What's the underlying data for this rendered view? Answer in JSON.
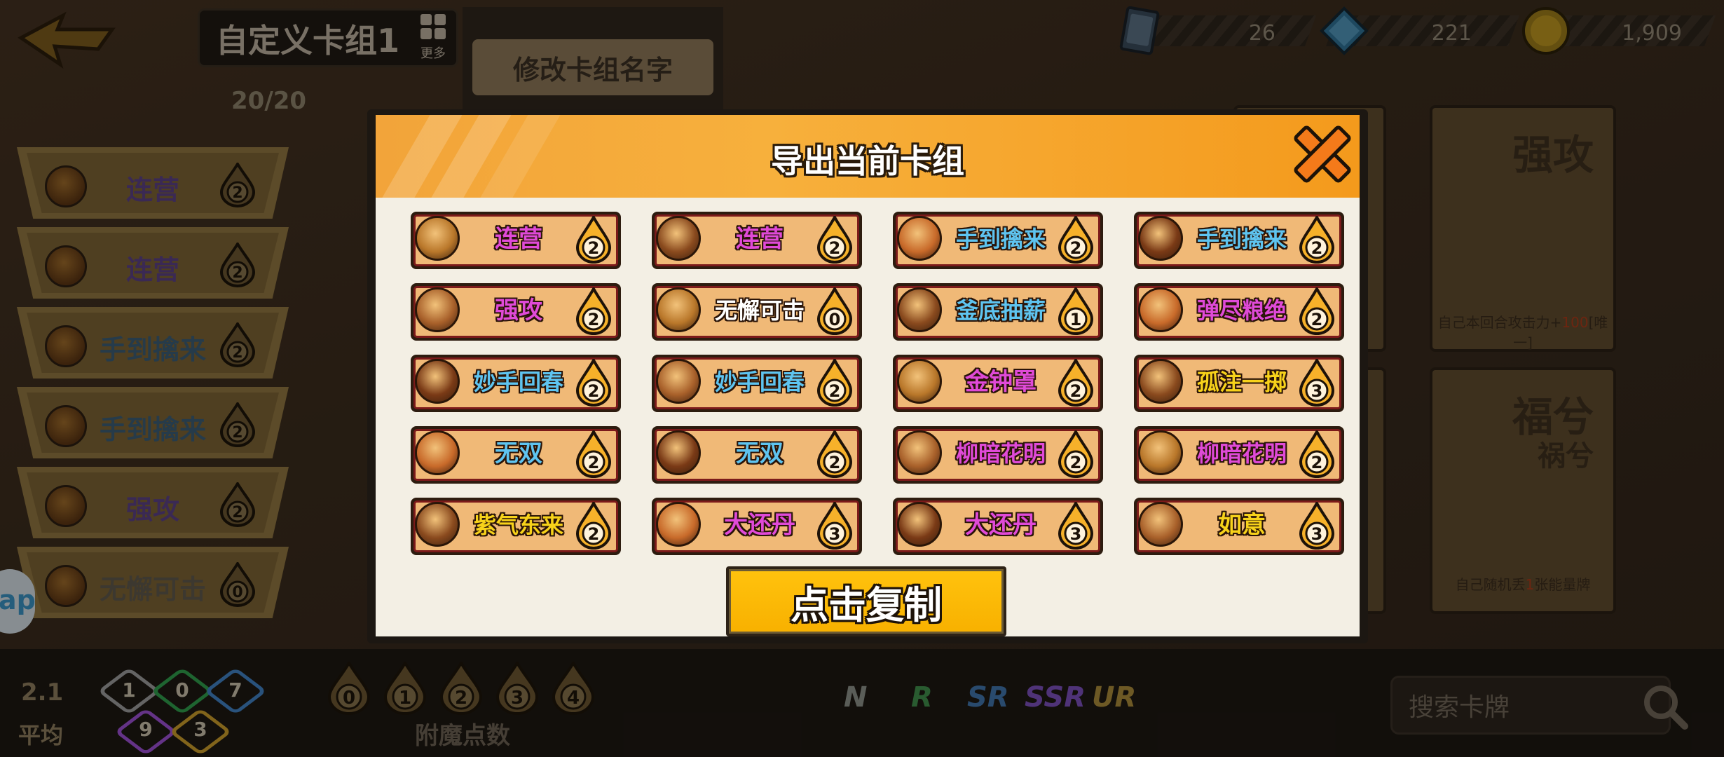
{
  "header": {
    "deck_name": "自定义卡组1",
    "more_label": "更多",
    "rename_button": "修改卡组名字",
    "deck_count": "20/20"
  },
  "currencies": [
    {
      "icon": "card-pack-icon",
      "value": "26"
    },
    {
      "icon": "diamond-icon",
      "value": "221"
    },
    {
      "icon": "coin-icon",
      "value": "1,909"
    }
  ],
  "left_list": [
    {
      "name": "连营",
      "cost": "2",
      "color": "#5a3f82"
    },
    {
      "name": "连营",
      "cost": "2",
      "color": "#5a3f82"
    },
    {
      "name": "手到擒来",
      "cost": "2",
      "color": "#3b5b72"
    },
    {
      "name": "手到擒来",
      "cost": "2",
      "color": "#3b5b72"
    },
    {
      "name": "强攻",
      "cost": "2",
      "color": "#5a3f82"
    },
    {
      "name": "无懈可击",
      "cost": "0",
      "color": "#5d564a"
    }
  ],
  "right_cards": [
    {
      "title": "强攻",
      "subtitle": "",
      "desc_prefix": "自己本回合攻击力+",
      "desc_value": "100",
      "desc_suffix": "[唯一]"
    },
    {
      "title": "福兮",
      "subtitle": "祸兮",
      "desc_prefix": "自己随机丢",
      "desc_value": "1",
      "desc_suffix": "张能量牌"
    }
  ],
  "modal": {
    "title": "导出当前卡组",
    "copy_button": "点击复制",
    "cards": [
      {
        "name": "连营",
        "cost": "2",
        "name_color": "#e04ad8",
        "avatar": "fox-warrior-avatar"
      },
      {
        "name": "连营",
        "cost": "2",
        "name_color": "#e04ad8",
        "avatar": "fox-warrior-avatar"
      },
      {
        "name": "手到擒来",
        "cost": "2",
        "name_color": "#5ec4f0",
        "avatar": "fox-grab-avatar"
      },
      {
        "name": "手到擒来",
        "cost": "2",
        "name_color": "#5ec4f0",
        "avatar": "fox-grab-avatar"
      },
      {
        "name": "强攻",
        "cost": "2",
        "name_color": "#e04ad8",
        "avatar": "monkey-attack-avatar"
      },
      {
        "name": "无懈可击",
        "cost": "0",
        "name_color": "#ffffff",
        "avatar": "duo-guard-avatar"
      },
      {
        "name": "釜底抽薪",
        "cost": "1",
        "name_color": "#5ec4f0",
        "avatar": "fox-steal-avatar"
      },
      {
        "name": "弹尽粮绝",
        "cost": "2",
        "name_color": "#e04ad8",
        "avatar": "chick-avatar"
      },
      {
        "name": "妙手回春",
        "cost": "2",
        "name_color": "#5ec4f0",
        "avatar": "healer-avatar"
      },
      {
        "name": "妙手回春",
        "cost": "2",
        "name_color": "#5ec4f0",
        "avatar": "healer-avatar"
      },
      {
        "name": "金钟罩",
        "cost": "2",
        "name_color": "#e04ad8",
        "avatar": "monk-avatar"
      },
      {
        "name": "孤注一掷",
        "cost": "3",
        "name_color": "#f7d21a",
        "avatar": "squirrel-avatar"
      },
      {
        "name": "无双",
        "cost": "2",
        "name_color": "#5ec4f0",
        "avatar": "cat-hero-avatar"
      },
      {
        "name": "无双",
        "cost": "2",
        "name_color": "#5ec4f0",
        "avatar": "cat-hero-avatar"
      },
      {
        "name": "柳暗花明",
        "cost": "2",
        "name_color": "#e04ad8",
        "avatar": "bear-avatar"
      },
      {
        "name": "柳暗花明",
        "cost": "2",
        "name_color": "#e04ad8",
        "avatar": "bear-avatar"
      },
      {
        "name": "紫气东来",
        "cost": "2",
        "name_color": "#f7d21a",
        "avatar": "sage-avatar"
      },
      {
        "name": "大还丹",
        "cost": "3",
        "name_color": "#e04ad8",
        "avatar": "pill-avatar"
      },
      {
        "name": "大还丹",
        "cost": "3",
        "name_color": "#e04ad8",
        "avatar": "pill-avatar"
      },
      {
        "name": "如意",
        "cost": "3",
        "name_color": "#f7d21a",
        "avatar": "fox-ruyi-avatar"
      }
    ]
  },
  "bottom": {
    "average_value": "2.1",
    "average_label": "平均",
    "rarity_counts": [
      {
        "label": "1",
        "color": "#9a9a9a"
      },
      {
        "label": "0",
        "color": "#2f9a4a"
      },
      {
        "label": "7",
        "color": "#3f7fbf"
      },
      {
        "label": "9",
        "color": "#9a4fd0"
      },
      {
        "label": "3",
        "color": "#c79a2a"
      }
    ],
    "cost_filters": [
      "0",
      "1",
      "2",
      "3",
      "4"
    ],
    "cost_filter_label": "附魔点数",
    "rarity_filters": [
      {
        "label": "N",
        "color": "#8a8f88"
      },
      {
        "label": "R",
        "color": "#3f8c4b"
      },
      {
        "label": "SR",
        "color": "#3f72a8"
      },
      {
        "label": "SSR",
        "color": "#7a4fb8"
      },
      {
        "label": "UR",
        "color": "#a8893a"
      }
    ],
    "search_placeholder": "搜索卡牌",
    "help_label": "ap"
  }
}
